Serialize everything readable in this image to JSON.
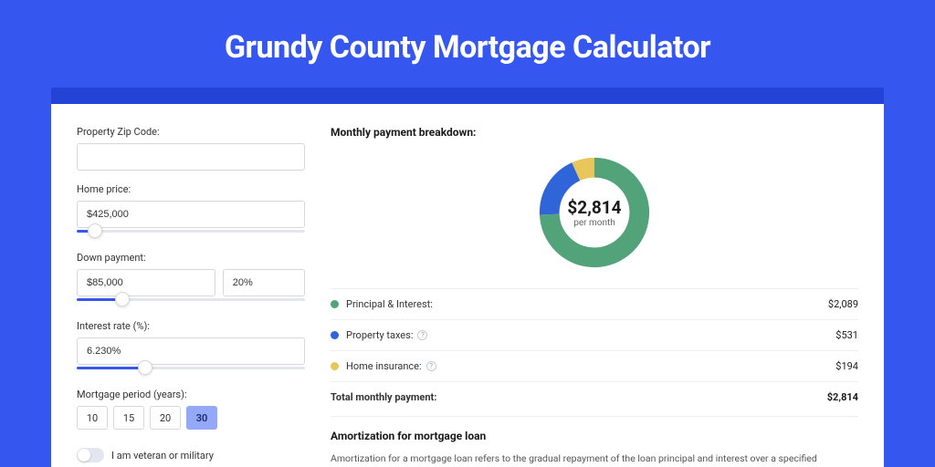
{
  "header": {
    "title": "Grundy County Mortgage Calculator"
  },
  "colors": {
    "green": "#53a37a",
    "blue": "#2f65d8",
    "yellow": "#e8c659"
  },
  "form": {
    "zip_label": "Property Zip Code:",
    "zip_value": "",
    "price_label": "Home price:",
    "price_value": "$425,000",
    "price_slider_pct": 8,
    "down_label": "Down payment:",
    "down_value": "$85,000",
    "down_pct_value": "20%",
    "down_slider_pct": 20,
    "rate_label": "Interest rate (%):",
    "rate_value": "6.230%",
    "rate_slider_pct": 30,
    "period_label": "Mortgage period (years):",
    "periods": [
      "10",
      "15",
      "20",
      "30"
    ],
    "period_active": "30",
    "veteran_label": "I am veteran or military",
    "veteran_on": false
  },
  "breakdown": {
    "title": "Monthly payment breakdown:",
    "center_amount": "$2,814",
    "center_sub": "per month",
    "items": [
      {
        "key": "pi",
        "label": "Principal & Interest:",
        "value": "$2,089",
        "info": false,
        "color": "green"
      },
      {
        "key": "tax",
        "label": "Property taxes:",
        "value": "$531",
        "info": true,
        "color": "blue"
      },
      {
        "key": "ins",
        "label": "Home insurance:",
        "value": "$194",
        "info": true,
        "color": "yellow"
      }
    ],
    "total_label": "Total monthly payment:",
    "total_value": "$2,814"
  },
  "chart_data": {
    "type": "pie",
    "title": "Monthly payment breakdown",
    "series": [
      {
        "name": "Principal & Interest",
        "value": 2089,
        "color": "#53a37a"
      },
      {
        "name": "Property taxes",
        "value": 531,
        "color": "#2f65d8"
      },
      {
        "name": "Home insurance",
        "value": 194,
        "color": "#e8c659"
      }
    ],
    "total": 2814,
    "center_label": "$2,814 per month"
  },
  "amort": {
    "heading": "Amortization for mortgage loan",
    "body": "Amortization for a mortgage loan refers to the gradual repayment of the loan principal and interest over a specified"
  }
}
